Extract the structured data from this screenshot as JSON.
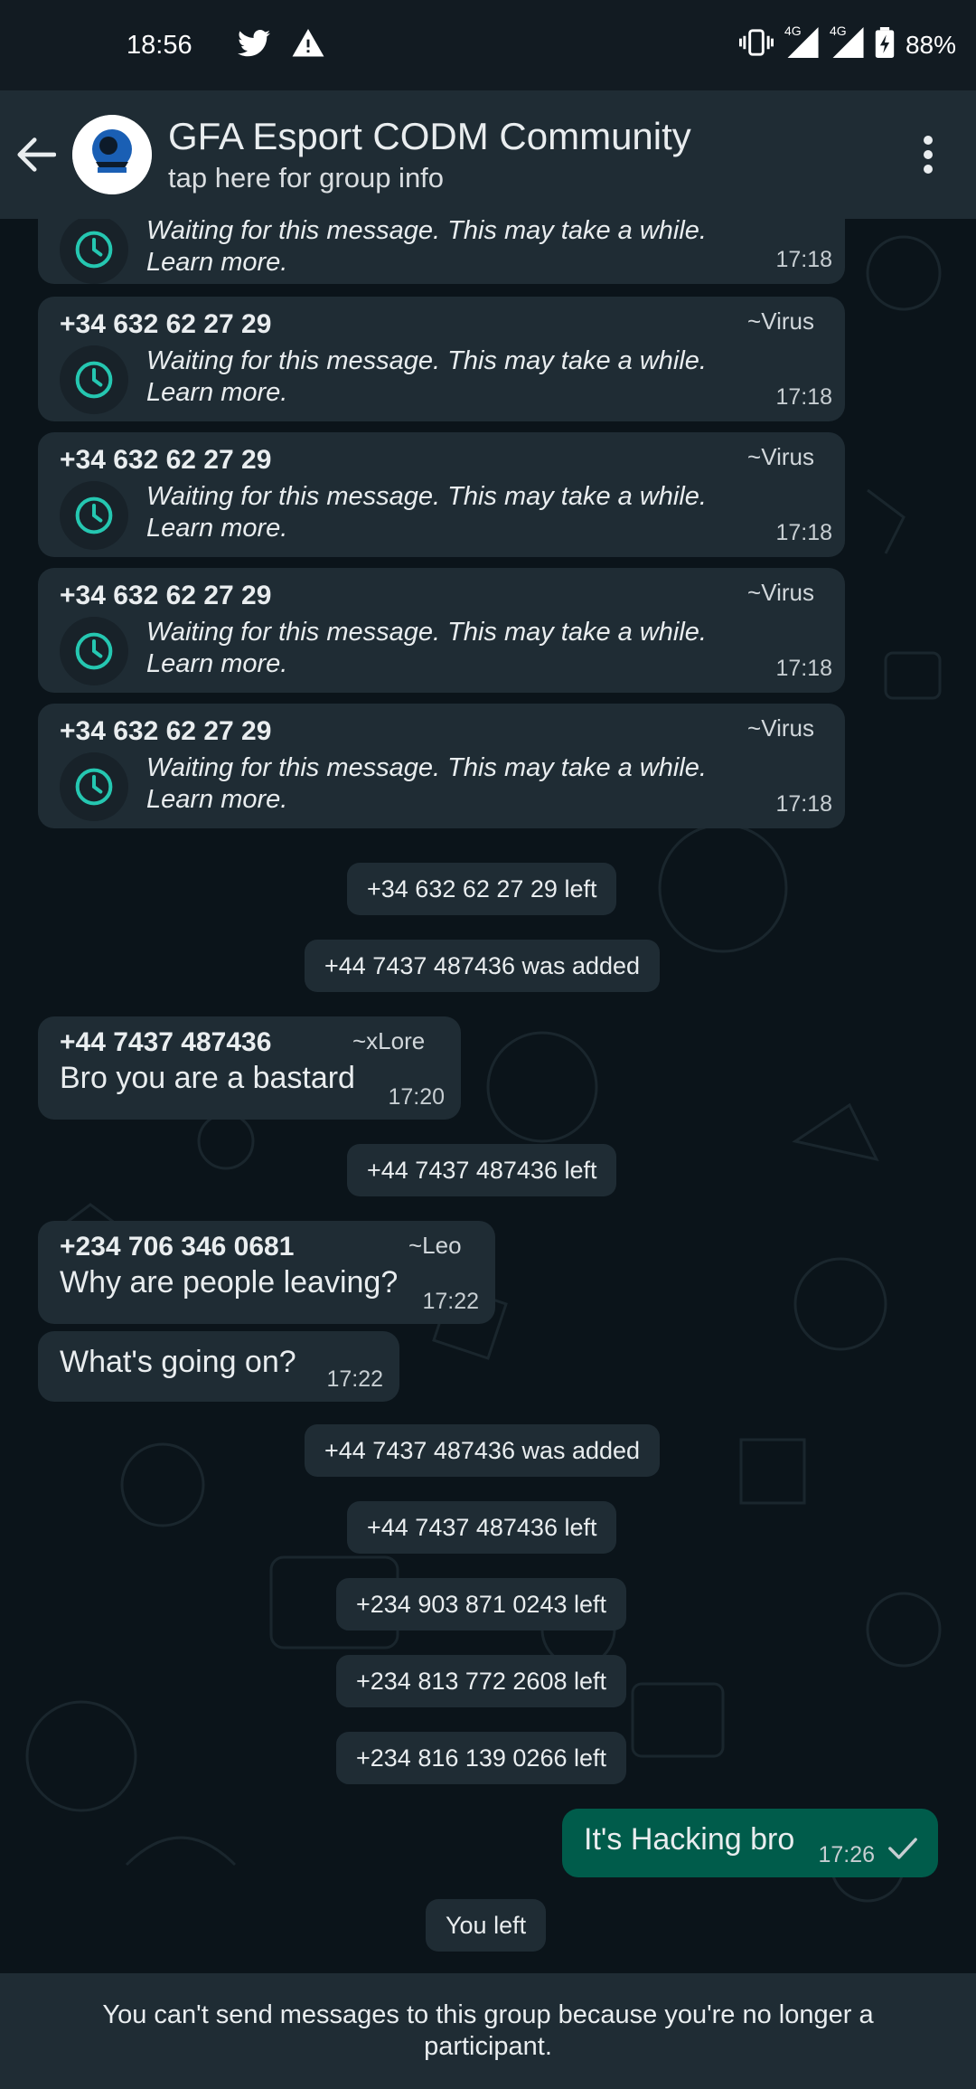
{
  "status_bar": {
    "time": "18:56",
    "signal_1": "4G",
    "signal_2": "4G",
    "battery": "88%"
  },
  "header": {
    "title": "GFA Esport CODM Community",
    "subtitle": "tap here for group info"
  },
  "pending_messages": [
    {
      "sender": "",
      "tag": "",
      "line1": "Waiting for this message. This may take a while.",
      "line2": "Learn more.",
      "time": "17:18"
    },
    {
      "sender": "+34 632 62 27 29",
      "tag": "~Virus",
      "line1": "Waiting for this message. This may take a while.",
      "line2": "Learn more.",
      "time": "17:18"
    },
    {
      "sender": "+34 632 62 27 29",
      "tag": "~Virus",
      "line1": "Waiting for this message. This may take a while.",
      "line2": "Learn more.",
      "time": "17:18"
    },
    {
      "sender": "+34 632 62 27 29",
      "tag": "~Virus",
      "line1": "Waiting for this message. This may take a while.",
      "line2": "Learn more.",
      "time": "17:18"
    },
    {
      "sender": "+34 632 62 27 29",
      "tag": "~Virus",
      "line1": "Waiting for this message. This may take a while.",
      "line2": "Learn more.",
      "time": "17:18"
    }
  ],
  "system_notices": [
    "+34 632 62 27 29 left",
    "+44 7437 487436 was added",
    "+44 7437 487436 left",
    "+44 7437 487436 was added",
    "+44 7437 487436 left",
    "+234 903 871 0243 left",
    "+234 813 772 2608 left",
    "+234 816 139 0266 left",
    "You left"
  ],
  "messages": [
    {
      "sender": "+44 7437 487436",
      "tag": "~xLore",
      "text": "Bro you are a bastard",
      "time": "17:20"
    },
    {
      "sender": "+234 706 346 0681",
      "tag": "~Leo",
      "text": "Why are people leaving?",
      "time": "17:22"
    },
    {
      "sender": "",
      "tag": "",
      "text": "What's going on?",
      "time": "17:22"
    },
    {
      "sender": "",
      "tag": "",
      "text": "It's Hacking bro",
      "time": "17:26",
      "status": "sent"
    }
  ],
  "footer": {
    "text": "You can't send messages to this group because you're no longer a participant."
  },
  "colors": {
    "background": "#0b141a",
    "header": "#1f2c34",
    "incoming_bubble": "#1f2c34",
    "outgoing_bubble": "#005c4b",
    "clock_accent": "#25c7b1"
  },
  "icons": {
    "back": "arrow-left-icon",
    "menu": "more-vertical-icon",
    "clock": "clock-icon",
    "check": "single-check-icon",
    "twitter": "twitter-icon",
    "warning": "warning-icon",
    "vibrate": "vibrate-icon",
    "signal": "signal-icon",
    "battery": "battery-charging-icon"
  }
}
